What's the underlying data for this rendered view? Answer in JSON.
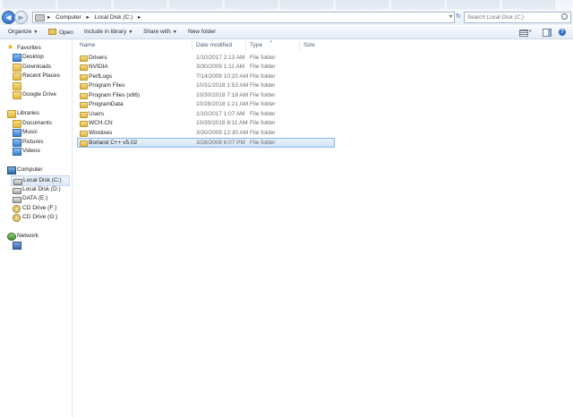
{
  "address": {
    "crumbs": [
      "Computer",
      "Local Disk (C:)"
    ]
  },
  "search": {
    "placeholder": "Search Local Disk (C:)"
  },
  "toolbar": {
    "organize": "Organize",
    "open": "Open",
    "include": "Include in library",
    "share": "Share with",
    "newfolder": "New folder"
  },
  "sidebar": {
    "favorites": {
      "header": "Favorites",
      "items": [
        "Desktop",
        "Downloads",
        "Recent Places",
        "",
        "Google Drive"
      ]
    },
    "libraries": {
      "header": "Libraries",
      "items": [
        "Documents",
        "Music",
        "Pictures",
        "Videos"
      ]
    },
    "computer": {
      "header": "Computer",
      "items": [
        "Local Disk (C:)",
        "Local Disk (D:)",
        "DATA (E:)",
        "CD Drive (F:)",
        "CD Drive (G:)"
      ]
    },
    "network": {
      "header": "Network"
    }
  },
  "columns": {
    "name": "Name",
    "date": "Date modified",
    "type": "Type",
    "size": "Size"
  },
  "files": [
    {
      "name": "Drivers",
      "date": "1/10/2017 2:13 AM",
      "type": "File folder"
    },
    {
      "name": "NVIDIA",
      "date": "3/30/2009 1:11 AM",
      "type": "File folder"
    },
    {
      "name": "PerfLogs",
      "date": "7/14/2009 10:20 AM",
      "type": "File folder"
    },
    {
      "name": "Program Files",
      "date": "10/31/2018 1:53 AM",
      "type": "File folder"
    },
    {
      "name": "Program Files (x86)",
      "date": "10/30/2018 7:18 AM",
      "type": "File folder"
    },
    {
      "name": "ProgramData",
      "date": "10/28/2018 1:21 AM",
      "type": "File folder"
    },
    {
      "name": "Users",
      "date": "1/10/2017 1:07 AM",
      "type": "File folder"
    },
    {
      "name": "WCH.CN",
      "date": "10/30/2018 8:11 AM",
      "type": "File folder"
    },
    {
      "name": "Windows",
      "date": "3/30/2009 12:30 AM",
      "type": "File folder"
    },
    {
      "name": "Borland C++ v5.02",
      "date": "3/28/2008 6:07 PM",
      "type": "File folder"
    }
  ]
}
